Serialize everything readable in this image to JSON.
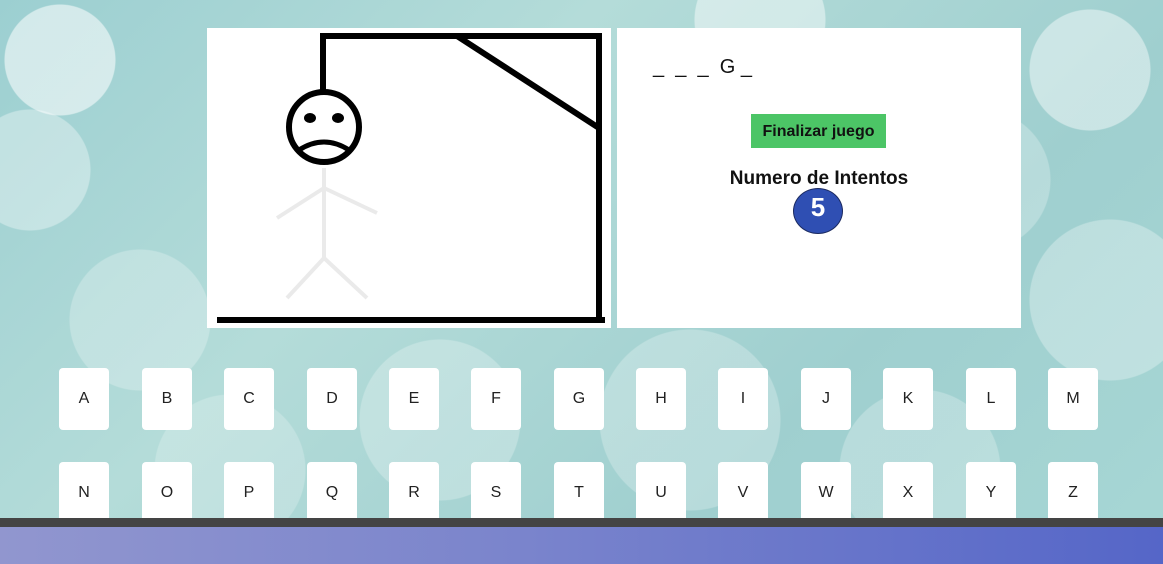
{
  "hangman": {
    "image_name": "hangman-drawing-sad-face",
    "attempts_shown": 1
  },
  "game": {
    "word_display": "_  _  _  G _",
    "finish_label": "Finalizar juego",
    "attempts_label": "Numero de Intentos",
    "attempts_value": "5"
  },
  "keyboard": {
    "row1": [
      "A",
      "B",
      "C",
      "D",
      "E",
      "F",
      "G",
      "H",
      "I",
      "J",
      "K",
      "L",
      "M"
    ],
    "row2": [
      "N",
      "O",
      "P",
      "Q",
      "R",
      "S",
      "T",
      "U",
      "V",
      "W",
      "X",
      "Y",
      "Z"
    ]
  },
  "colors": {
    "finish_button": "#4cc566",
    "attempts_badge": "#2f4fb3",
    "footer_start": "#9196cf",
    "footer_end": "#5566c8"
  }
}
